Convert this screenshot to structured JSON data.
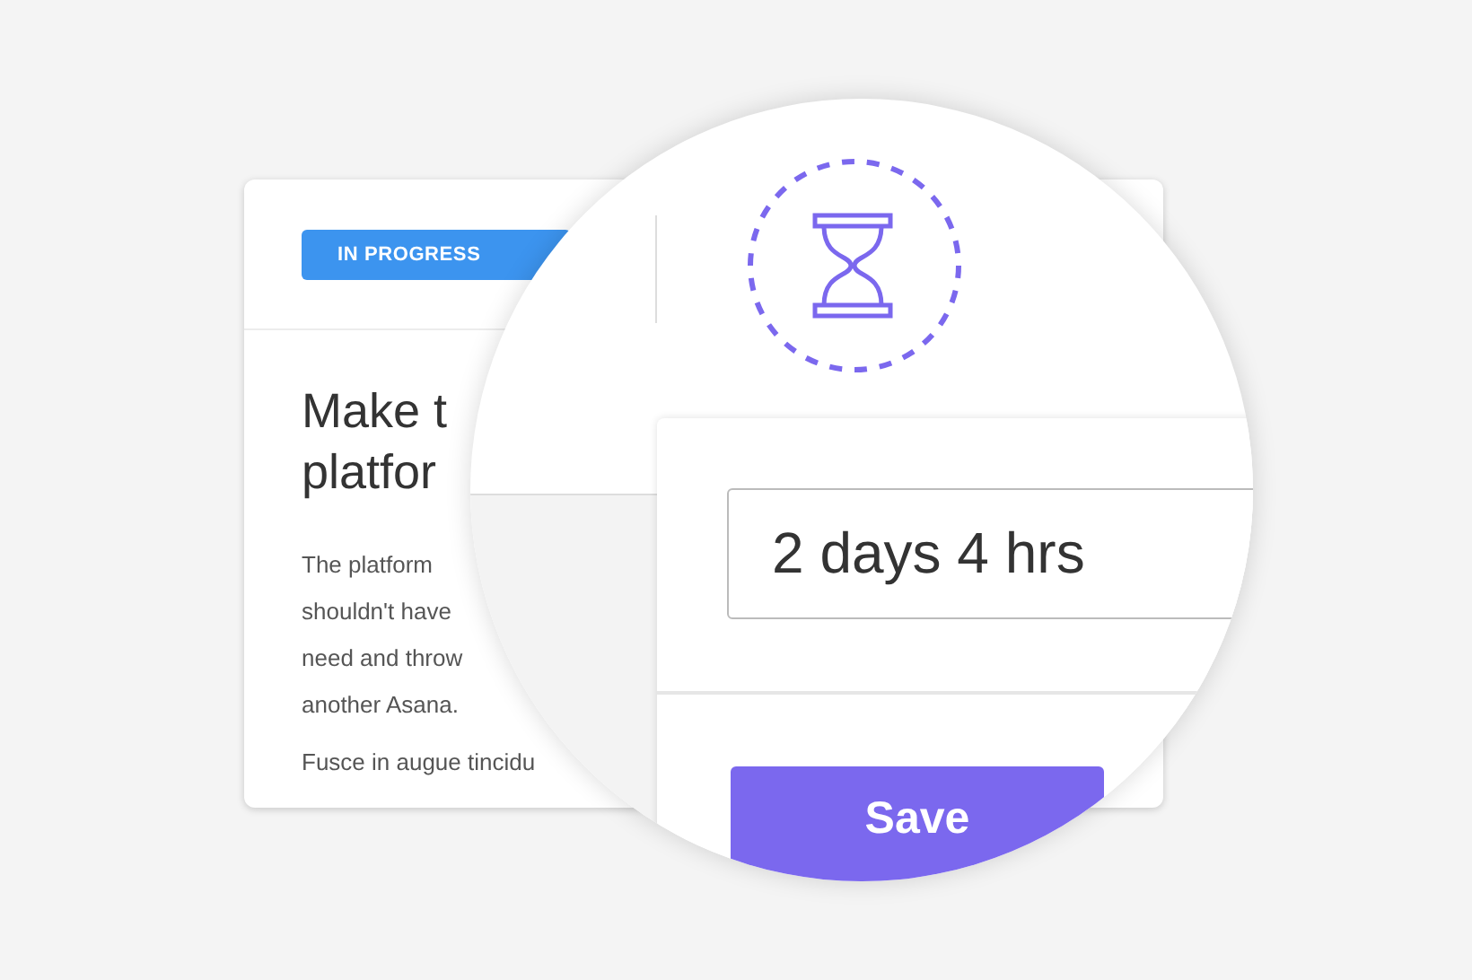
{
  "card": {
    "status_button": {
      "label": "IN PROGRESS"
    },
    "title_lines": [
      "Make t",
      "platfor"
    ],
    "paragraph_lines": [
      "The platform",
      "shouldn't have",
      "need and throw",
      "another Asana."
    ],
    "second_paragraph": "Fusce in augue tincidu"
  },
  "magnifier": {
    "duration_field": {
      "value": "2 days 4 hrs"
    },
    "save_button": {
      "label": "Save"
    }
  }
}
